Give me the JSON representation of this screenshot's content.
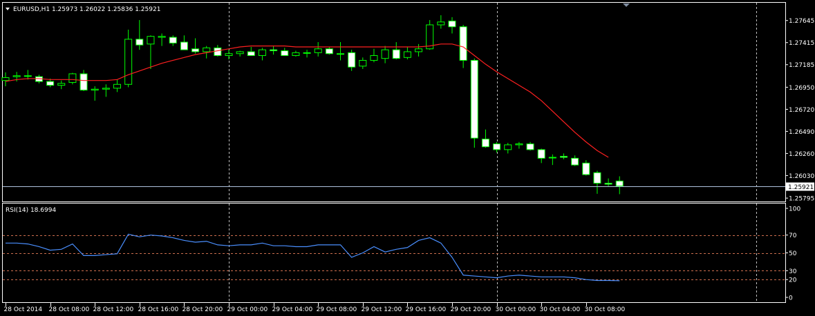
{
  "chart_data": [
    {
      "type": "candlestick",
      "info_text": "EURUSD,H1  1.25973 1.26022 1.25836 1.25921",
      "symbol": "EURUSD",
      "timeframe": "H1",
      "last_ohlc": [
        1.25973,
        1.26022,
        1.25836,
        1.25921
      ],
      "ylim": [
        1.2576,
        1.2783
      ],
      "price_ticks": [
        "1.27645",
        "1.27415",
        "1.27185",
        "1.26950",
        "1.26720",
        "1.26490",
        "1.26260",
        "1.26030",
        "1.25795"
      ],
      "current_price_label": "1.25921",
      "current_price": 1.25921,
      "grid": "vertical dashed",
      "moving_average": {
        "color": "#ff2020"
      },
      "bull_color": "#000000",
      "bear_color": "#ffffff",
      "wick_color": "#00ff00",
      "candles": [
        {
          "o": 1.2702,
          "h": 1.27105,
          "l": 1.2696,
          "c": 1.2705
        },
        {
          "o": 1.2706,
          "h": 1.2711,
          "l": 1.2701,
          "c": 1.2707
        },
        {
          "o": 1.2707,
          "h": 1.2713,
          "l": 1.2703,
          "c": 1.2707
        },
        {
          "o": 1.2706,
          "h": 1.2708,
          "l": 1.2699,
          "c": 1.2701
        },
        {
          "o": 1.2701,
          "h": 1.2704,
          "l": 1.2695,
          "c": 1.2697
        },
        {
          "o": 1.2697,
          "h": 1.2702,
          "l": 1.2693,
          "c": 1.2699
        },
        {
          "o": 1.27,
          "h": 1.271,
          "l": 1.2698,
          "c": 1.2709
        },
        {
          "o": 1.2709,
          "h": 1.2713,
          "l": 1.2691,
          "c": 1.2692
        },
        {
          "o": 1.2692,
          "h": 1.2696,
          "l": 1.2681,
          "c": 1.2693
        },
        {
          "o": 1.2693,
          "h": 1.2698,
          "l": 1.2685,
          "c": 1.2694
        },
        {
          "o": 1.2694,
          "h": 1.2703,
          "l": 1.269,
          "c": 1.2698
        },
        {
          "o": 1.2698,
          "h": 1.2755,
          "l": 1.2695,
          "c": 1.2745
        },
        {
          "o": 1.2745,
          "h": 1.2765,
          "l": 1.2734,
          "c": 1.2739
        },
        {
          "o": 1.274,
          "h": 1.2749,
          "l": 1.2714,
          "c": 1.2748
        },
        {
          "o": 1.2747,
          "h": 1.2751,
          "l": 1.2738,
          "c": 1.2748
        },
        {
          "o": 1.2747,
          "h": 1.2749,
          "l": 1.2738,
          "c": 1.2741
        },
        {
          "o": 1.2742,
          "h": 1.2749,
          "l": 1.2736,
          "c": 1.2734
        },
        {
          "o": 1.2735,
          "h": 1.2746,
          "l": 1.273,
          "c": 1.2732
        },
        {
          "o": 1.2732,
          "h": 1.2738,
          "l": 1.2725,
          "c": 1.2736
        },
        {
          "o": 1.2736,
          "h": 1.2739,
          "l": 1.2727,
          "c": 1.2728
        },
        {
          "o": 1.2728,
          "h": 1.2734,
          "l": 1.2724,
          "c": 1.273
        },
        {
          "o": 1.273,
          "h": 1.2733,
          "l": 1.2727,
          "c": 1.2732
        },
        {
          "o": 1.2732,
          "h": 1.2737,
          "l": 1.2728,
          "c": 1.2728
        },
        {
          "o": 1.2728,
          "h": 1.2736,
          "l": 1.2723,
          "c": 1.2734
        },
        {
          "o": 1.2734,
          "h": 1.2738,
          "l": 1.2729,
          "c": 1.2733
        },
        {
          "o": 1.2733,
          "h": 1.2736,
          "l": 1.2728,
          "c": 1.2728
        },
        {
          "o": 1.2728,
          "h": 1.2733,
          "l": 1.2727,
          "c": 1.2731
        },
        {
          "o": 1.2731,
          "h": 1.2734,
          "l": 1.2726,
          "c": 1.2731
        },
        {
          "o": 1.2731,
          "h": 1.2742,
          "l": 1.2727,
          "c": 1.2735
        },
        {
          "o": 1.2735,
          "h": 1.2737,
          "l": 1.2729,
          "c": 1.273
        },
        {
          "o": 1.273,
          "h": 1.2742,
          "l": 1.2723,
          "c": 1.273
        },
        {
          "o": 1.2731,
          "h": 1.2734,
          "l": 1.2712,
          "c": 1.2716
        },
        {
          "o": 1.2717,
          "h": 1.2726,
          "l": 1.2714,
          "c": 1.2723
        },
        {
          "o": 1.2723,
          "h": 1.2735,
          "l": 1.2721,
          "c": 1.2728
        },
        {
          "o": 1.2725,
          "h": 1.2738,
          "l": 1.272,
          "c": 1.2734
        },
        {
          "o": 1.2734,
          "h": 1.2742,
          "l": 1.2724,
          "c": 1.2725
        },
        {
          "o": 1.2726,
          "h": 1.2737,
          "l": 1.2724,
          "c": 1.2732
        },
        {
          "o": 1.2732,
          "h": 1.274,
          "l": 1.2727,
          "c": 1.2735
        },
        {
          "o": 1.2735,
          "h": 1.2765,
          "l": 1.2734,
          "c": 1.276
        },
        {
          "o": 1.276,
          "h": 1.277,
          "l": 1.2756,
          "c": 1.2763
        },
        {
          "o": 1.2764,
          "h": 1.2768,
          "l": 1.2751,
          "c": 1.2758
        },
        {
          "o": 1.2758,
          "h": 1.276,
          "l": 1.2715,
          "c": 1.2723
        },
        {
          "o": 1.2723,
          "h": 1.2725,
          "l": 1.2632,
          "c": 1.2642
        },
        {
          "o": 1.2641,
          "h": 1.2651,
          "l": 1.2632,
          "c": 1.2633
        },
        {
          "o": 1.2636,
          "h": 1.2638,
          "l": 1.2627,
          "c": 1.263
        },
        {
          "o": 1.263,
          "h": 1.2637,
          "l": 1.2626,
          "c": 1.2635
        },
        {
          "o": 1.2635,
          "h": 1.2638,
          "l": 1.2631,
          "c": 1.2636
        },
        {
          "o": 1.2636,
          "h": 1.2638,
          "l": 1.2629,
          "c": 1.263
        },
        {
          "o": 1.263,
          "h": 1.2631,
          "l": 1.2616,
          "c": 1.2621
        },
        {
          "o": 1.2622,
          "h": 1.2625,
          "l": 1.2614,
          "c": 1.2622
        },
        {
          "o": 1.2623,
          "h": 1.2626,
          "l": 1.262,
          "c": 1.2622
        },
        {
          "o": 1.2621,
          "h": 1.2624,
          "l": 1.2613,
          "c": 1.2614
        },
        {
          "o": 1.2616,
          "h": 1.2619,
          "l": 1.2603,
          "c": 1.2604
        },
        {
          "o": 1.2606,
          "h": 1.2608,
          "l": 1.2584,
          "c": 1.2595
        },
        {
          "o": 1.2595,
          "h": 1.26,
          "l": 1.2592,
          "c": 1.2594
        },
        {
          "o": 1.25973,
          "h": 1.26022,
          "l": 1.25836,
          "c": 1.25921
        }
      ],
      "ma_values": [
        1.2701,
        1.2703,
        1.2704,
        1.2704,
        1.2703,
        1.2703,
        1.2703,
        1.2702,
        1.2702,
        1.2702,
        1.2703,
        1.2708,
        1.2712,
        1.2716,
        1.272,
        1.2723,
        1.2726,
        1.2729,
        1.2731,
        1.2733,
        1.2735,
        1.2737,
        1.2738,
        1.2738,
        1.2738,
        1.2738,
        1.2737,
        1.2737,
        1.2737,
        1.2737,
        1.2737,
        1.2737,
        1.2737,
        1.2737,
        1.2737,
        1.2737,
        1.2737,
        1.2737,
        1.2738,
        1.274,
        1.274,
        1.2737,
        1.2728,
        1.2719,
        1.2711,
        1.2704,
        1.2697,
        1.269,
        1.2681,
        1.267,
        1.2659,
        1.2648,
        1.2638,
        1.2629,
        1.2622
      ]
    },
    {
      "type": "line",
      "info_text": "RSI(14) 18.6994",
      "indicator": "RSI(14)",
      "last_value": 18.6994,
      "ylim": [
        0,
        100
      ],
      "levels": [
        70,
        50,
        30,
        20
      ],
      "level_color": "#d07050",
      "y_ticks": [
        "100",
        "70",
        "50",
        "30",
        "20",
        "0"
      ],
      "line_color": "#4a8fff",
      "values": [
        61,
        61,
        60,
        57,
        53,
        54,
        60,
        47,
        47,
        48,
        49,
        71,
        68,
        70,
        69,
        67,
        64,
        62,
        63,
        59,
        58,
        59,
        59,
        61,
        58,
        58,
        57,
        57,
        59,
        59,
        59,
        45,
        50,
        57,
        51,
        54,
        56,
        64,
        67,
        61,
        45,
        25,
        24,
        23,
        22,
        24,
        25,
        24,
        23,
        23,
        23,
        22,
        20,
        19,
        19,
        18.7
      ]
    }
  ],
  "x_axis": {
    "labels": [
      "28 Oct 2014",
      "28 Oct 08:00",
      "28 Oct 12:00",
      "28 Oct 16:00",
      "28 Oct 20:00",
      "29 Oct 00:00",
      "29 Oct 04:00",
      "29 Oct 08:00",
      "29 Oct 12:00",
      "29 Oct 16:00",
      "29 Oct 20:00",
      "30 Oct 00:00",
      "30 Oct 04:00",
      "30 Oct 08:00"
    ]
  },
  "colors": {
    "background": "#000000",
    "frame": "#ffffff",
    "text": "#ffffff",
    "grid": "#c0c0c0",
    "price_line": "#b0c4de"
  }
}
